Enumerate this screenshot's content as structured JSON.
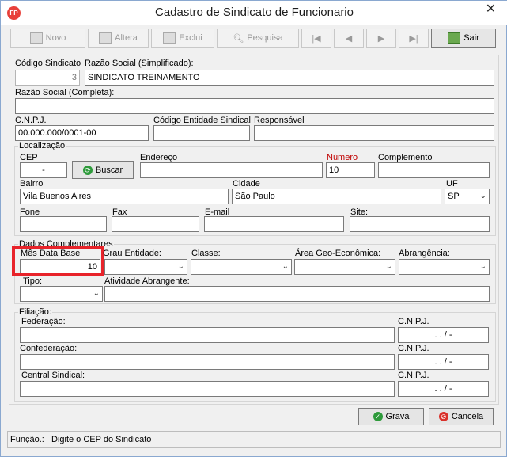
{
  "window": {
    "title": "Cadastro de Sindicato de Funcionario",
    "close": "✕",
    "app_icon": "FP"
  },
  "toolbar": {
    "novo": "Novo",
    "altera": "Altera",
    "exclui": "Exclui",
    "pesquisa": "Pesquisa",
    "first": "|◀",
    "prev": "◀",
    "next": "▶",
    "last": "▶|",
    "sair": "Sair"
  },
  "form": {
    "codigo_sindicato": {
      "label": "Código Sindicato",
      "value": "3"
    },
    "razao_simplificada": {
      "label": "Razão Social (Simplificado):",
      "value": "SINDICATO TREINAMENTO"
    },
    "razao_completa": {
      "label": "Razão Social (Completa):",
      "value": ""
    },
    "cnpj": {
      "label": "C.N.P.J.",
      "value": "00.000.000/0001-00"
    },
    "codigo_entidade": {
      "label": "Código Entidade Sindical",
      "value": ""
    },
    "responsavel": {
      "label": "Responsável",
      "value": ""
    }
  },
  "localizacao": {
    "title": "Localização",
    "cep": {
      "label": "CEP",
      "value": "-"
    },
    "buscar": "Buscar",
    "endereco": {
      "label": "Endereço",
      "value": ""
    },
    "numero": {
      "label": "Número",
      "value": "10"
    },
    "complemento": {
      "label": "Complemento",
      "value": ""
    },
    "bairro": {
      "label": "Bairro",
      "value": "Vila Buenos Aires"
    },
    "cidade": {
      "label": "Cidade",
      "value": "São Paulo"
    },
    "uf": {
      "label": "UF",
      "value": "SP"
    },
    "fone": {
      "label": "Fone",
      "value": ""
    },
    "fax": {
      "label": "Fax",
      "value": ""
    },
    "email": {
      "label": "E-mail",
      "value": ""
    },
    "site": {
      "label": "Site:",
      "value": ""
    }
  },
  "complementares": {
    "title": "Dados Complementares",
    "mes_data_base": {
      "label": "Mês Data Base",
      "value": "10"
    },
    "grau_entidade": {
      "label": "Grau Entidade:",
      "value": ""
    },
    "classe": {
      "label": "Classe:",
      "value": ""
    },
    "area_geo": {
      "label": "Área Geo-Econômica:",
      "value": ""
    },
    "abrangencia": {
      "label": "Abrangência:",
      "value": ""
    },
    "tipo": {
      "label": "Tipo:",
      "value": ""
    },
    "atividade": {
      "label": "Atividade Abrangente:",
      "value": ""
    }
  },
  "filiacao": {
    "title": "Filiação:",
    "federacao": {
      "label": "Federação:",
      "value": ""
    },
    "confederacao": {
      "label": "Confederação:",
      "value": ""
    },
    "central": {
      "label": "Central Sindical:",
      "value": ""
    },
    "cnpj_label": "C.N.P.J.",
    "cnpj_mask": ". . / -"
  },
  "actions": {
    "grava": "Grava",
    "cancela": "Cancela"
  },
  "status": {
    "label": "Função.:",
    "text": "Digite o CEP do Sindicato"
  },
  "colors": {
    "highlight": "#e8232a",
    "numero_label": "#c00000"
  }
}
